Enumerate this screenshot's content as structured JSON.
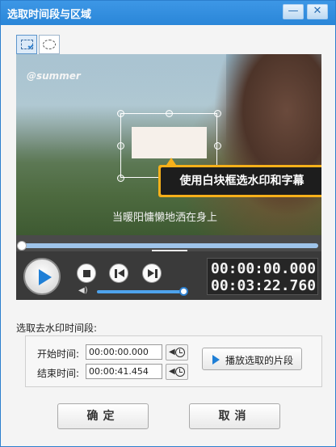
{
  "window": {
    "title": "选取时间段与区域",
    "minimize_glyph": "—",
    "close_glyph": "✕"
  },
  "selection_tools": [
    {
      "name": "rectangle-select",
      "icon": "dashed-rectangle-icon",
      "active": true
    },
    {
      "name": "ellipse-select",
      "icon": "dashed-ellipse-icon",
      "active": false
    }
  ],
  "preview": {
    "watermark_text": "@summer",
    "subtitle_text": "当暖阳慵懒地洒在身上",
    "tip_text": "使用白块框选水印和字幕"
  },
  "player": {
    "progress": 0.0,
    "volume": 0.95,
    "current_time": "00:00:00.000",
    "total_time": "00:03:22.760",
    "expand_glyph": "⌄",
    "volume_glyph": "◀)"
  },
  "time_range": {
    "section_label": "选取去水印时间段:",
    "start_label": "开始时间:",
    "start_value": "00:00:00.000",
    "end_label": "结束时间:",
    "end_value": "00:00:41.454",
    "clock_arrow_glyph": "◀",
    "play_selection_label": "播放选取的片段"
  },
  "footer": {
    "ok_label": "确定",
    "cancel_label": "取消"
  },
  "colors": {
    "title_bar": "#2a86d8",
    "accent_blue": "#1f7fd6",
    "tip_orange": "#f6b01a"
  }
}
